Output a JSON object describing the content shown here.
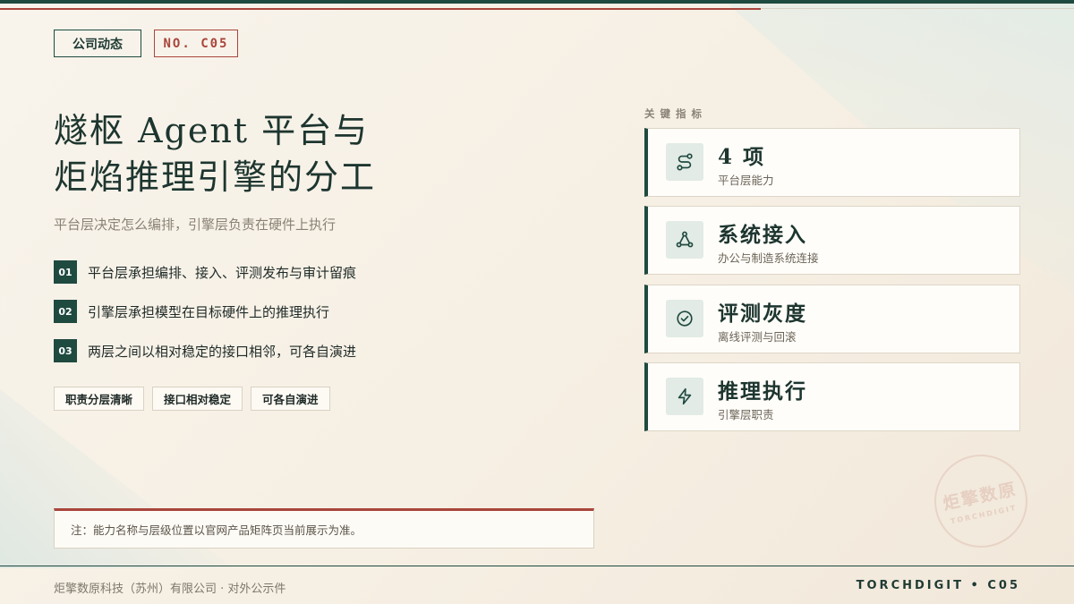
{
  "header": {
    "category_tag": "公司动态",
    "number_tag": "NO. C05"
  },
  "main": {
    "title_line1": "燧枢 Agent 平台与",
    "title_line2": "炬焰推理引擎的分工",
    "subtitle": "平台层决定怎么编排，引擎层负责在硬件上执行",
    "points": [
      {
        "num": "01",
        "text": "平台层承担编排、接入、评测发布与审计留痕"
      },
      {
        "num": "02",
        "text": "引擎层承担模型在目标硬件上的推理执行"
      },
      {
        "num": "03",
        "text": "两层之间以相对稳定的接口相邻，可各自演进"
      }
    ],
    "chips": [
      "职责分层清晰",
      "接口相对稳定",
      "可各自演进"
    ],
    "note": "注：能力名称与层级位置以官网产品矩阵页当前展示为准。"
  },
  "metrics": {
    "label": "关键指标",
    "items": [
      {
        "icon": "route-icon",
        "value": "4 项",
        "desc": "平台层能力"
      },
      {
        "icon": "network-icon",
        "value": "系统接入",
        "desc": "办公与制造系统连接"
      },
      {
        "icon": "check-circle-icon",
        "value": "评测灰度",
        "desc": "离线评测与回滚"
      },
      {
        "icon": "lightning-icon",
        "value": "推理执行",
        "desc": "引擎层职责"
      }
    ]
  },
  "stamp": {
    "cn": "炬擎数原",
    "en": "TORCHDIGIT"
  },
  "footer": {
    "company": "炬擎数原科技（苏州）有限公司 · 对外公示件",
    "code": "TORCHDIGIT • C05"
  },
  "colors": {
    "primary": "#1f4a40",
    "accent": "#a9453b",
    "background": "#f6efe3"
  }
}
